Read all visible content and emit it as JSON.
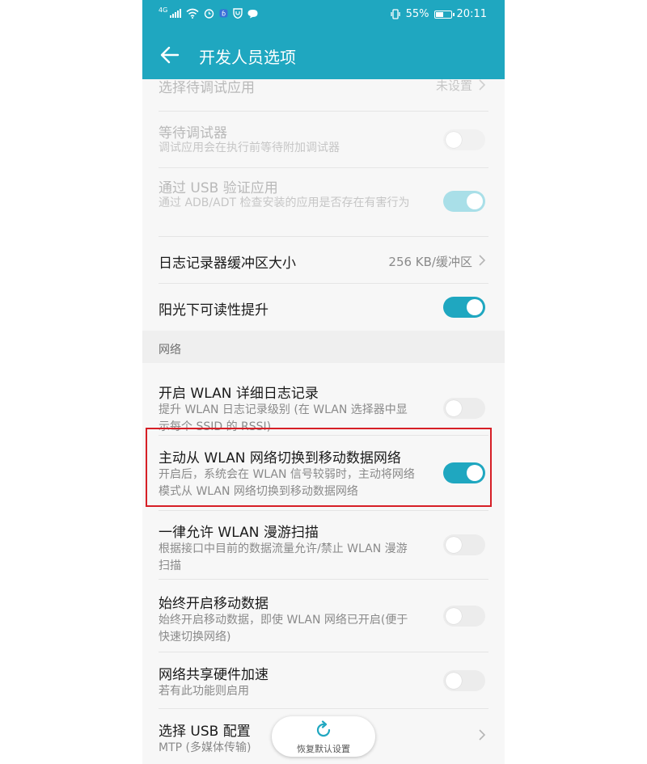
{
  "status": {
    "net_label": "4G",
    "battery": "55%",
    "time": "20:11",
    "battery_level": 0.55,
    "icons": [
      "signal-icon",
      "wifi-icon",
      "alarm-icon",
      "app-icon",
      "shield-icon",
      "chat-icon",
      "vibrate-icon",
      "battery-icon"
    ]
  },
  "appbar": {
    "title": "开发人员选项",
    "back_icon": "arrow-left-icon"
  },
  "rows": [
    {
      "title": "选择待调试应用",
      "value": "未设置",
      "disabled": true
    },
    {
      "title": "等待调试器",
      "subtitle": "调试应用会在执行前等待附加调试器",
      "toggle": false,
      "disabled": true
    },
    {
      "title": "通过 USB 验证应用",
      "subtitle": "通过 ADB/ADT 检查安装的应用是否存在有害行为",
      "toggle": true,
      "disabled": true
    },
    {
      "title": "日志记录器缓冲区大小",
      "value": "256 KB/缓冲区"
    },
    {
      "title": "阳光下可读性提升",
      "toggle": true
    }
  ],
  "network_section": {
    "header": "网络",
    "rows": [
      {
        "title": "开启 WLAN 详细日志记录",
        "subtitle": "提升 WLAN 日志记录级别 (在 WLAN 选择器中显示每个 SSID 的 RSSI)",
        "toggle": false
      },
      {
        "title": "主动从 WLAN 网络切换到移动数据网络",
        "subtitle": "开启后，系统会在 WLAN 信号较弱时，主动将网络模式从 WLAN 网络切换到移动数据网络",
        "toggle": true
      },
      {
        "title": "一律允许 WLAN 漫游扫描",
        "subtitle": "根据接口中目前的数据流量允许/禁止 WLAN 漫游扫描",
        "toggle": false
      },
      {
        "title": "始终开启移动数据",
        "subtitle": "始终开启移动数据，即使 WLAN 网络已开启(便于快速切换网络)",
        "toggle": false
      },
      {
        "title": "网络共享硬件加速",
        "subtitle": "若有此功能则启用",
        "toggle": false
      },
      {
        "title": "选择 USB 配置",
        "subtitle": "MTP (多媒体传输)"
      }
    ]
  },
  "reset_button": {
    "label": "恢复默认设置",
    "icon": "refresh-icon"
  },
  "colors": {
    "accent": "#1fa7c0",
    "highlight": "#d61f26"
  }
}
